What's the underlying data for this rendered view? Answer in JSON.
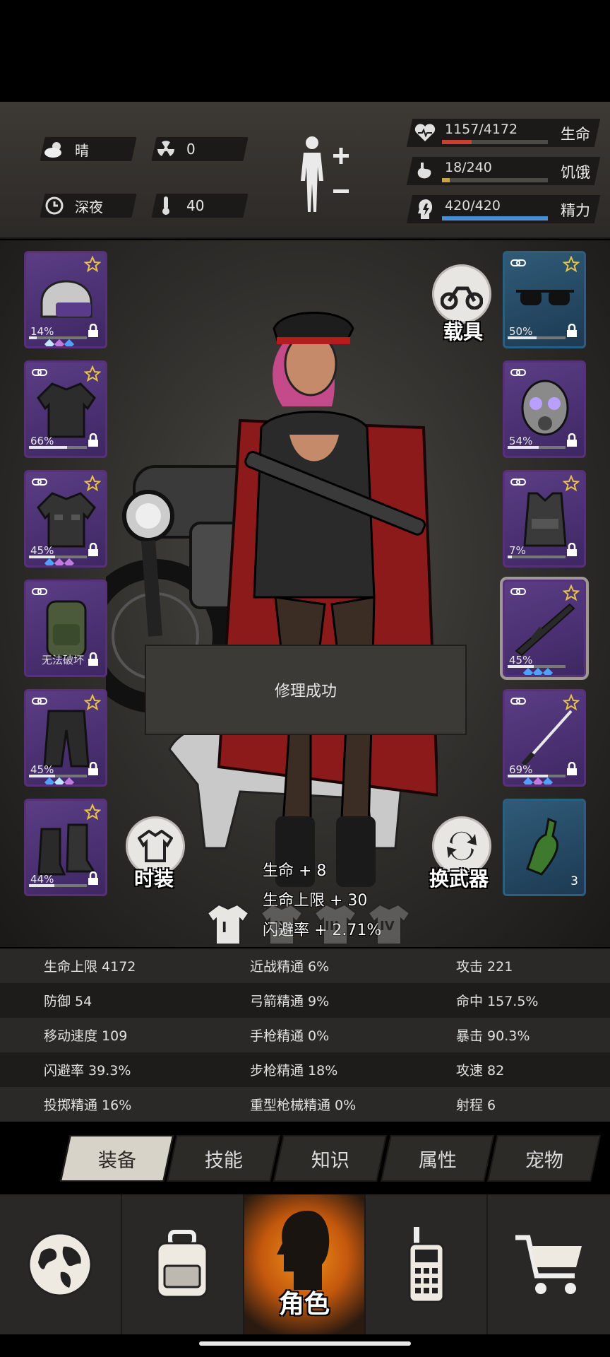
{
  "status": {
    "weather": "晴",
    "radiation": "0",
    "time_of_day": "深夜",
    "temperature": "40"
  },
  "vitals": [
    {
      "name": "生命",
      "value": "1157/4172",
      "ratio": 0.277,
      "color": "#c8412e"
    },
    {
      "name": "饥饿",
      "value": "18/240",
      "ratio": 0.075,
      "color": "#c9a24a"
    },
    {
      "name": "精力",
      "value": "420/420",
      "ratio": 1.0,
      "color": "#4a8fd0"
    }
  ],
  "left_slots": [
    {
      "item": "police-helmet",
      "pct": "14%",
      "durability": 0.14,
      "gems": [
        "#bfe6ff",
        "#c07ae0",
        "#4fa0ff"
      ]
    },
    {
      "item": "jacket",
      "pct": "66%",
      "durability": 0.66,
      "gems": []
    },
    {
      "item": "coat",
      "pct": "45%",
      "durability": 0.45,
      "gems": [
        "#4fa0ff",
        "#c07ae0",
        "#c07ae0"
      ]
    },
    {
      "item": "backpack",
      "status_text": "无法破坏"
    },
    {
      "item": "pants",
      "pct": "45%",
      "durability": 0.45,
      "gems": [
        "#4fa0ff",
        "#bfe6ff",
        "#c07ae0"
      ]
    },
    {
      "item": "boots",
      "pct": "44%",
      "durability": 0.44,
      "gems": []
    }
  ],
  "right_slots": [
    {
      "item": "sunglasses",
      "pct": "50%",
      "durability": 0.5,
      "gems": []
    },
    {
      "item": "gas-mask",
      "pct": "54%",
      "durability": 0.54,
      "gems": []
    },
    {
      "item": "body-armor",
      "pct": "7%",
      "durability": 0.07,
      "gems": []
    },
    {
      "item": "assault-rifle",
      "pct": "45%",
      "durability": 0.45,
      "gems": [
        "#4fa0ff",
        "#4fa0ff",
        "#4fa0ff"
      ]
    },
    {
      "item": "katana",
      "pct": "69%",
      "durability": 0.69,
      "gems": [
        "#4fa0ff",
        "#c07ae0",
        "#4fa0ff"
      ]
    },
    {
      "item": "molotov",
      "count": "3"
    }
  ],
  "buttons": {
    "vehicle": "载具",
    "fashion": "时装",
    "switch_weapon": "换武器"
  },
  "toast": "修理成功",
  "bonuses": [
    "生命 + 8",
    "生命上限 + 30",
    "闪避率 + 2.71%"
  ],
  "outfit_tabs": [
    "I",
    "II",
    "III",
    "IV"
  ],
  "attributes": [
    [
      "生命上限 4172",
      "近战精通 6%",
      "攻击 221"
    ],
    [
      "防御 54",
      "弓箭精通 9%",
      "命中 157.5%"
    ],
    [
      "移动速度 109",
      "手枪精通 0%",
      "暴击 90.3%"
    ],
    [
      "闪避率 39.3%",
      "步枪精通 18%",
      "攻速 82"
    ],
    [
      "投掷精通 16%",
      "重型枪械精通 0%",
      "射程 6"
    ]
  ],
  "subtabs": [
    "装备",
    "技能",
    "知识",
    "属性",
    "宠物"
  ],
  "nav": {
    "character_label": "角色"
  }
}
